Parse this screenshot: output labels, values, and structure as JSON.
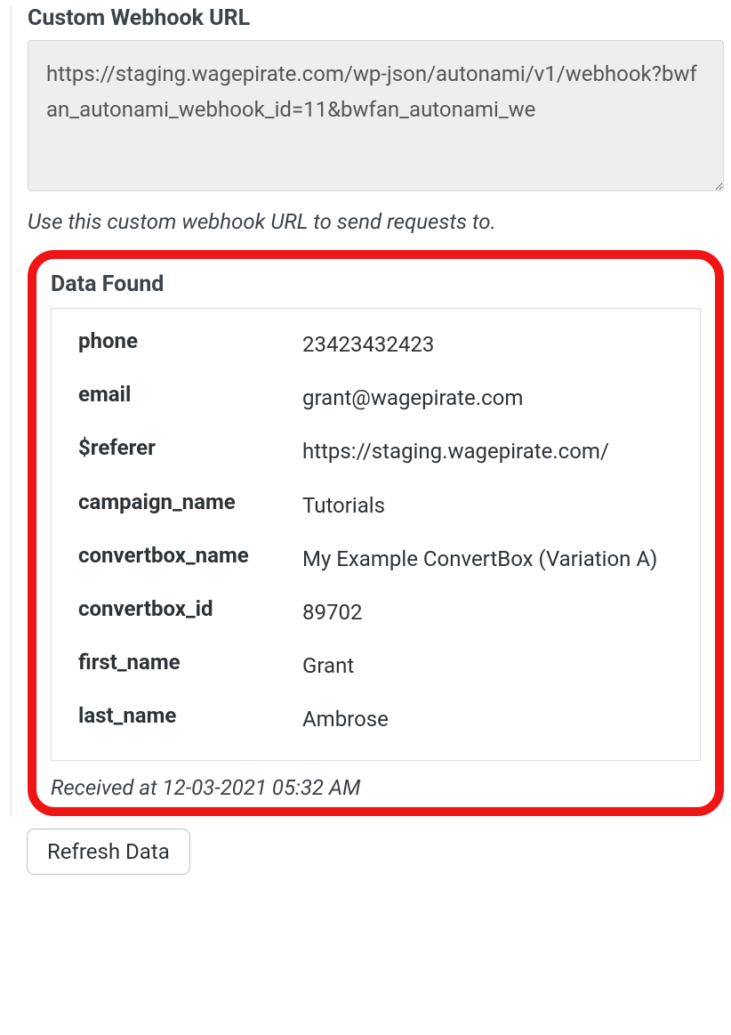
{
  "webhook": {
    "label": "Custom Webhook URL",
    "url": "https://staging.wagepirate.com/wp-json/autonami/v1/webhook?bwfan_autonami_webhook_id=11&bwfan_autonami_we",
    "help_text": "Use this custom webhook URL to send requests to."
  },
  "data_found": {
    "title": "Data Found",
    "rows": [
      {
        "key": "phone",
        "value": "23423432423"
      },
      {
        "key": "email",
        "value": "grant@wagepirate.com"
      },
      {
        "key": "$referer",
        "value": "https://staging.wagepirate.com/"
      },
      {
        "key": "campaign_name",
        "value": "Tutorials"
      },
      {
        "key": "convertbox_name",
        "value": "My Example ConvertBox (Variation A)"
      },
      {
        "key": "convertbox_id",
        "value": "89702"
      },
      {
        "key": "first_name",
        "value": "Grant"
      },
      {
        "key": "last_name",
        "value": "Ambrose"
      }
    ],
    "received_at": "Received at 12-03-2021 05:32 AM"
  },
  "buttons": {
    "refresh": "Refresh Data"
  }
}
